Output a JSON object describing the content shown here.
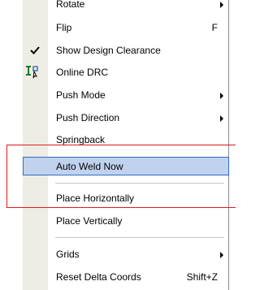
{
  "menu": {
    "items": [
      {
        "label": "Rotate",
        "shortcut": "",
        "submenu": true
      },
      {
        "label": "Flip",
        "shortcut": "F",
        "submenu": false
      },
      {
        "label": "Show Design Clearance",
        "shortcut": "",
        "submenu": false,
        "checked": true
      },
      {
        "label": "Online DRC",
        "shortcut": "",
        "submenu": false,
        "icon": "drc-icon"
      },
      {
        "label": "Push Mode",
        "shortcut": "",
        "submenu": true
      },
      {
        "label": "Push Direction",
        "shortcut": "",
        "submenu": true
      },
      {
        "label": "Springback",
        "shortcut": "",
        "submenu": false
      },
      {
        "label": "Auto Weld Now",
        "shortcut": "",
        "submenu": false,
        "highlighted": true
      },
      {
        "label": "Place Horizontally",
        "shortcut": "",
        "submenu": false
      },
      {
        "label": "Place Vertically",
        "shortcut": "",
        "submenu": false
      },
      {
        "label": "Grids",
        "shortcut": "",
        "submenu": true
      },
      {
        "label": "Reset Delta Coords",
        "shortcut": "Shift+Z",
        "submenu": false
      }
    ]
  },
  "colors": {
    "highlight_bg": "#c1d2ee",
    "highlight_border": "#316ac5",
    "callout": "#e0191e",
    "gutter": "#eeede5"
  }
}
